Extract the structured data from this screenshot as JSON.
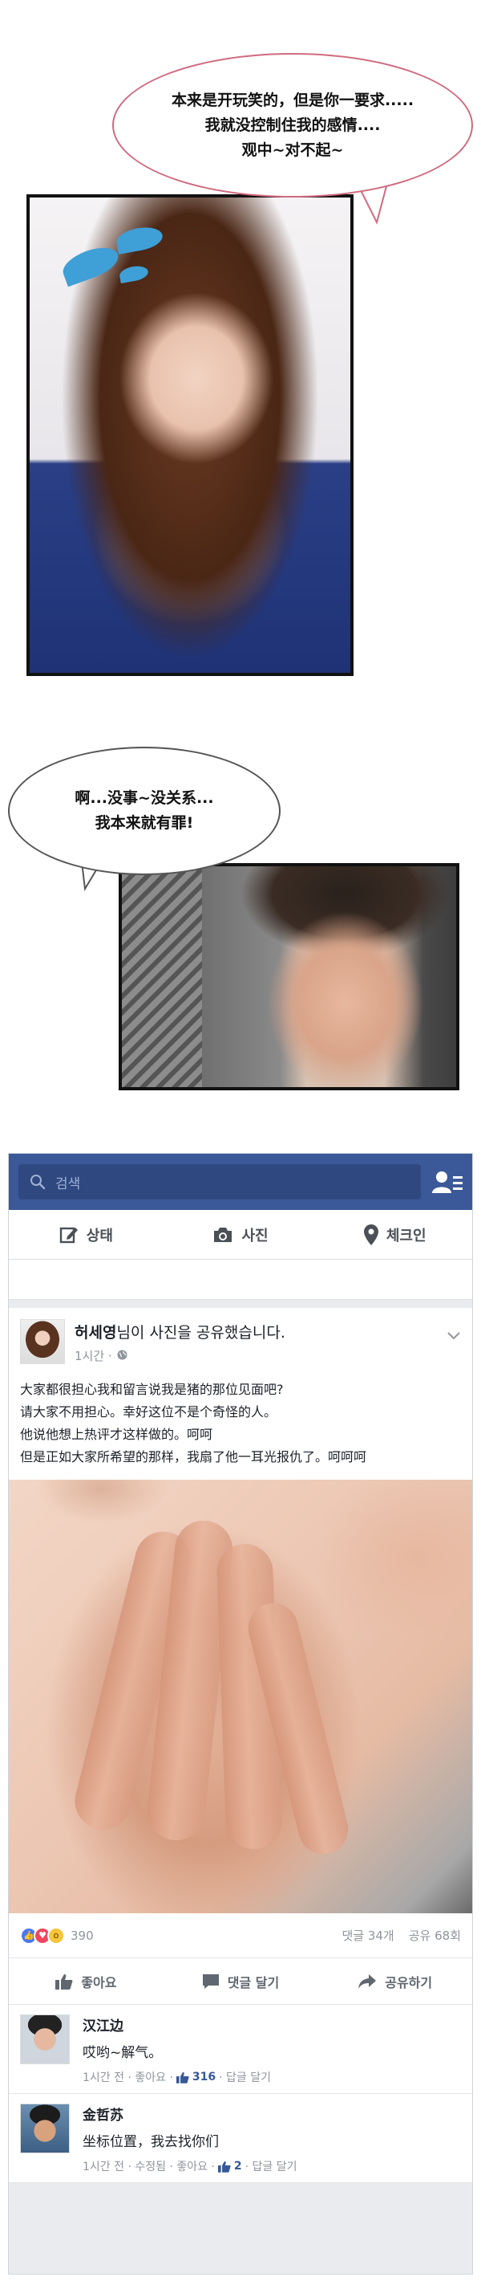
{
  "panel1": {
    "bubble_text": "本来是开玩笑的，但是你一要求.....\n我就没控制住我的感情....\n观中~对不起~"
  },
  "panel2": {
    "bubble_text": "啊...没事~没关系...\n我本来就有罪!"
  },
  "facebook": {
    "search_placeholder": "검색",
    "friends_icon": "friend-requests-icon",
    "composer": {
      "status_label": "상태",
      "photo_label": "사진",
      "checkin_label": "체크인"
    },
    "post": {
      "author": "허세영",
      "author_suffix": "님이 사진을 공유했습니다.",
      "time": "1시간 ·",
      "lines": [
        "大家都很担心我和留言说我是猪的那位见面吧?",
        "请大家不用担心。幸好这位不是个奇怪的人。",
        "他说他想上热评才这样做的。呵呵",
        "但是正如大家所希望的那样，我扇了他一耳光报仇了。呵呵呵"
      ],
      "reaction_count": "390",
      "comments_label": "댓글 34개",
      "shares_label": "공유 68회",
      "like_btn": "좋아요",
      "comment_btn": "댓글 달기",
      "share_btn": "공유하기"
    },
    "comments": [
      {
        "name": "汉江边",
        "text": "哎哟~解气。",
        "meta_prefix": "1시간 전 · 좋아요 ·",
        "likes": "316",
        "meta_suffix": "· 답글 달기"
      },
      {
        "name": "金哲苏",
        "text": "坐标位置，我去找你们",
        "meta_prefix": "1시간 전 · 수정됨 · 좋아요 ·",
        "likes": "2",
        "meta_suffix": "· 답글 달기"
      }
    ],
    "colors": {
      "brand": "#3b5998",
      "link": "#365899",
      "muted": "#90949c"
    }
  }
}
